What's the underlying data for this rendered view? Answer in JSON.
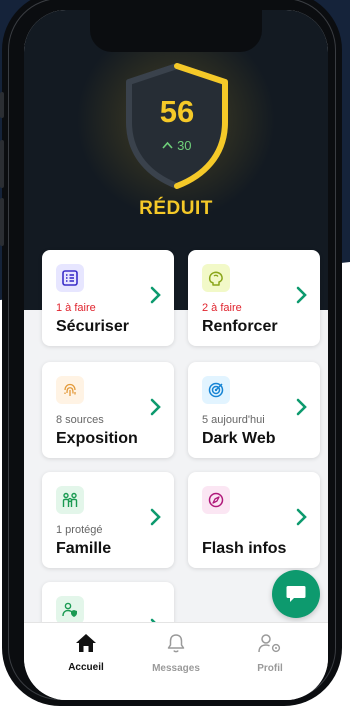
{
  "score": {
    "value": "56",
    "delta": "30",
    "status": "RÉDUIT"
  },
  "cards": [
    {
      "id": "securiser",
      "subtitle": "1 à faire",
      "title": "Sécuriser"
    },
    {
      "id": "renforcer",
      "subtitle": "2 à faire",
      "title": "Renforcer"
    },
    {
      "id": "exposition",
      "subtitle": "8 sources",
      "title": "Exposition"
    },
    {
      "id": "dark-web",
      "subtitle": "5 aujourd'hui",
      "title": "Dark Web"
    },
    {
      "id": "famille",
      "subtitle": "1 protégé",
      "title": "Famille"
    },
    {
      "id": "flash-infos",
      "subtitle": "",
      "title": "Flash infos"
    }
  ],
  "tabs": [
    {
      "label": "Accueil",
      "active": true
    },
    {
      "label": "Messages",
      "active": false
    },
    {
      "label": "Profil",
      "active": false
    }
  ],
  "colors": {
    "accent": "#f5c928",
    "positive": "#6fd07a",
    "todo": "#e0242e",
    "chevron": "#0d9a6e",
    "fab": "#0d9a6e"
  },
  "icons": {
    "securiser": "checklist-icon",
    "renforcer": "brain-icon",
    "exposition": "fingerprint-icon",
    "dark-web": "radar-target-icon",
    "famille": "family-icon",
    "flash-infos": "compass-icon",
    "partial": "user-shield-icon",
    "fab": "chat-icon",
    "accueil": "home-icon",
    "messages": "bell-icon",
    "profil": "user-settings-icon"
  }
}
